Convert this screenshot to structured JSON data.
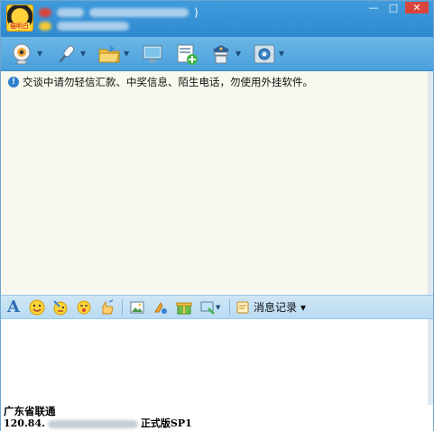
{
  "window": {
    "user_badge": "猫明白",
    "name_suffix": ")",
    "buttons": {
      "minimize": "—",
      "maximize": "□",
      "close": "✕"
    }
  },
  "toolbar": {
    "items": [
      {
        "icon": "webcam-icon",
        "has_menu": true
      },
      {
        "icon": "microphone-icon",
        "has_menu": true
      },
      {
        "icon": "folder-icon",
        "has_menu": true
      },
      {
        "icon": "screen-icon",
        "has_menu": false
      },
      {
        "icon": "add-note-icon",
        "has_menu": false
      },
      {
        "icon": "police-icon",
        "has_menu": true
      },
      {
        "icon": "settings-icon",
        "has_menu": true
      }
    ]
  },
  "notice": {
    "icon": "info-shield-icon",
    "text": "交谈中请勿轻信汇款、中奖信息、陌生电话，勿使用外挂软件。"
  },
  "format_toolbar": {
    "history_label": "消息记录",
    "history_arrow": "▾",
    "items": [
      "font-icon",
      "emoji-icon",
      "magic-emoji-icon",
      "shake-icon",
      "hand-icon",
      "image-icon",
      "screenshot-icon",
      "gift-icon",
      "screen-capture-icon"
    ]
  },
  "footer": {
    "location": "广东省联通",
    "ip_prefix": "120.84.",
    "version": "正式版SP1"
  },
  "colors": {
    "title_bar": "#3f9bdc",
    "toolbar": "#5aaae0",
    "chat_bg": "#f8f8ee"
  }
}
